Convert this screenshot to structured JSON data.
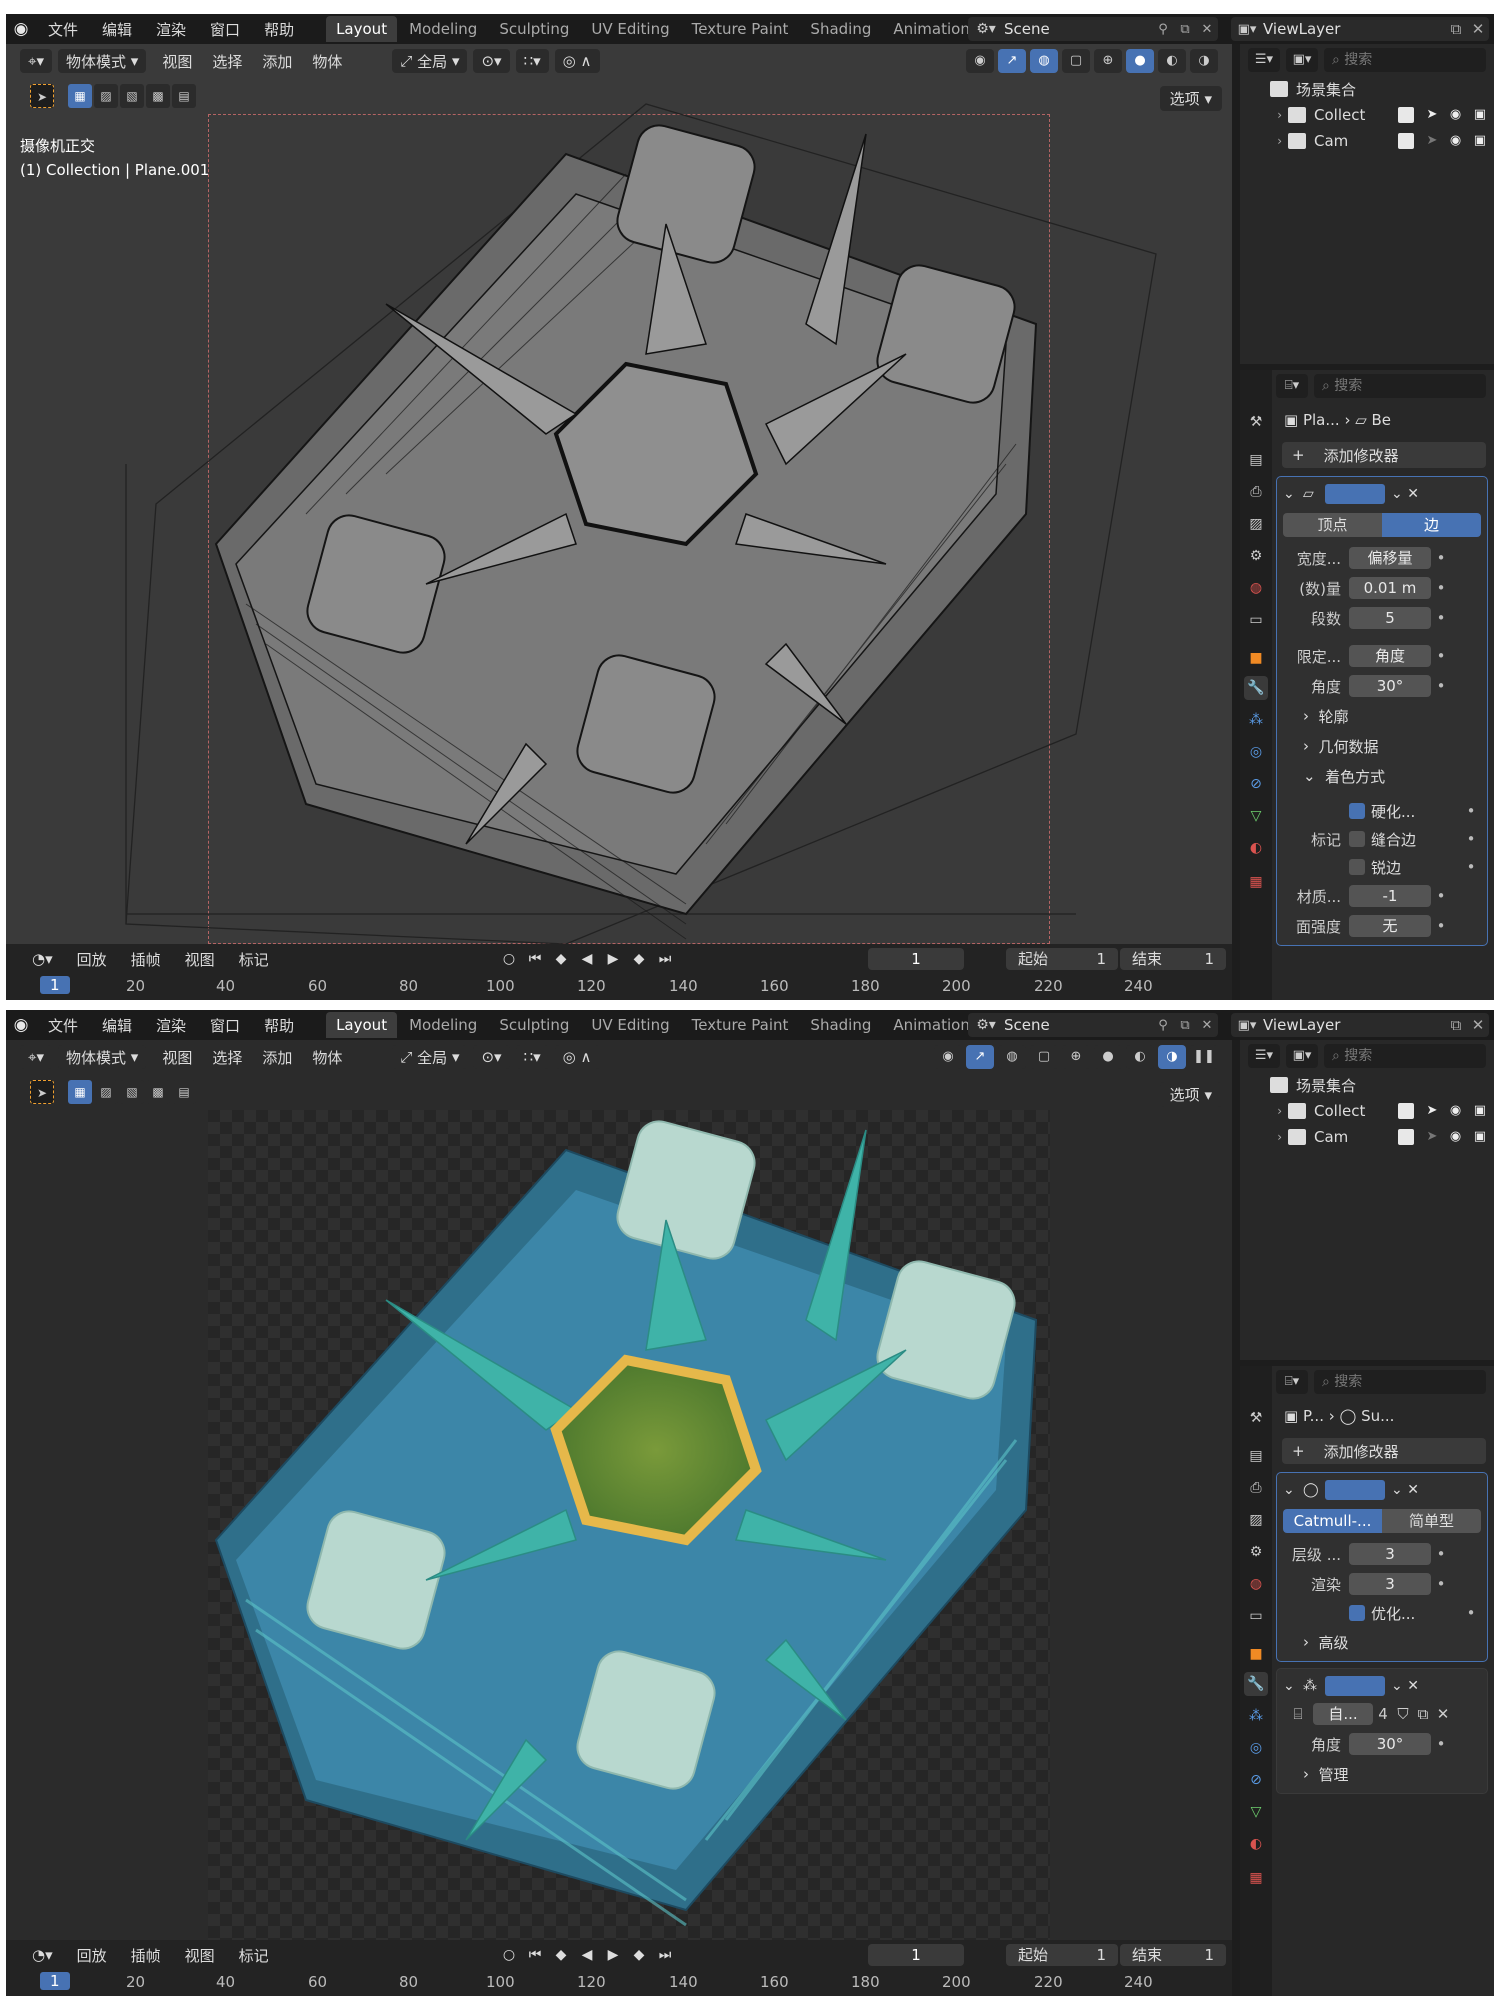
{
  "topbar": {
    "menu": [
      "文件",
      "编辑",
      "渲染",
      "窗口",
      "帮助"
    ],
    "workspaces": [
      "Layout",
      "Modeling",
      "Sculpting",
      "UV Editing",
      "Texture Paint",
      "Shading",
      "Animation"
    ],
    "scene": "Scene",
    "view_layer": "ViewLayer"
  },
  "viewport": {
    "mode": "物体模式",
    "menu": [
      "视图",
      "选择",
      "添加",
      "物体"
    ],
    "transform": "全局",
    "options": "选项"
  },
  "shot1": {
    "overlay_view": "摄像机正交",
    "overlay_object": "(1) Collection | Plane.001",
    "crumb_object": "Pla...",
    "crumb_data": "Be"
  },
  "shot2": {
    "crumb_object": "P...",
    "crumb_data": "Su..."
  },
  "timeline": {
    "menu": [
      "回放",
      "插帧",
      "视图",
      "标记"
    ],
    "current_frame": "1",
    "start_label": "起始",
    "start_value": "1",
    "end_label": "结束",
    "end_value": "1",
    "ruler": [
      "1",
      "20",
      "40",
      "60",
      "80",
      "100",
      "120",
      "140",
      "160",
      "180",
      "200",
      "220",
      "240"
    ]
  },
  "outliner": {
    "search_placeholder": "搜索",
    "root": "场景集合",
    "items": [
      "Collect",
      "Cam"
    ]
  },
  "properties": {
    "search_placeholder": "搜索",
    "add_modifier": "添加修改器"
  },
  "bevel": {
    "tabs": [
      "顶点",
      "边"
    ],
    "width_type_label": "宽度...",
    "width_type_value": "偏移量",
    "amount_label": "(数)量",
    "amount_value": "0.01 m",
    "segments_label": "段数",
    "segments_value": "5",
    "limit_label": "限定...",
    "limit_value": "角度",
    "angle_label": "角度",
    "angle_value": "30°",
    "sub_profile": "轮廓",
    "sub_geometry": "几何数据",
    "sub_shading": "着色方式",
    "harden_label": "硬化...",
    "mark_label": "标记",
    "seam_label": "缝合边",
    "sharp_label": "锐边",
    "material_label": "材质...",
    "material_value": "-1",
    "face_label": "面强度",
    "face_value": "无"
  },
  "subsurf": {
    "tabs": [
      "Catmull-...",
      "简单型"
    ],
    "levels_label": "层级 ...",
    "levels_value": "3",
    "render_label": "渲染",
    "render_value": "3",
    "optimal_label": "优化...",
    "advanced": "高级"
  },
  "autosmooth": {
    "name": "自...",
    "count": "4",
    "angle_label": "角度",
    "angle_value": "30°",
    "manage": "管理"
  }
}
